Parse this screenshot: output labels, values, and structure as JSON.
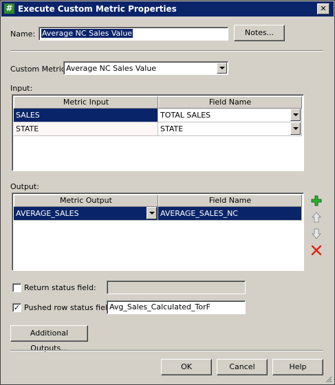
{
  "window": {
    "title": "Execute Custom Metric Properties",
    "icon": "hash-icon"
  },
  "name_row": {
    "label": "Name:",
    "value": "Average NC Sales Value",
    "notes_label": "Notes..."
  },
  "custom_metric": {
    "label": "Custom Metric:",
    "value": "Average NC Sales Value"
  },
  "input": {
    "label": "Input:",
    "columns": [
      "Metric Input",
      "Field Name"
    ],
    "rows": [
      {
        "metric": "SALES",
        "field": "TOTAL SALES"
      },
      {
        "metric": "STATE",
        "field": "STATE"
      }
    ]
  },
  "output": {
    "label": "Output:",
    "columns": [
      "Metric Output",
      "Field Name"
    ],
    "rows": [
      {
        "metric": "AVERAGE_SALES",
        "field": "AVERAGE_SALES_NC"
      }
    ]
  },
  "side_icons": [
    "add-icon",
    "move-up-icon",
    "move-down-icon",
    "delete-icon"
  ],
  "return_status": {
    "label": "Return status field:",
    "checked": false,
    "value": ""
  },
  "pushed_status": {
    "label": "Pushed row status field:",
    "checked": true,
    "value": "Avg_Sales_Calculated_TorF"
  },
  "buttons": {
    "additional": "Additional Outputs...",
    "ok": "OK",
    "cancel": "Cancel",
    "help": "Help"
  },
  "colors": {
    "titlebar": "#0a246a",
    "selection": "#0a246a",
    "face": "#d4d0c8",
    "add": "#2eae2e",
    "delete": "#e02010"
  }
}
